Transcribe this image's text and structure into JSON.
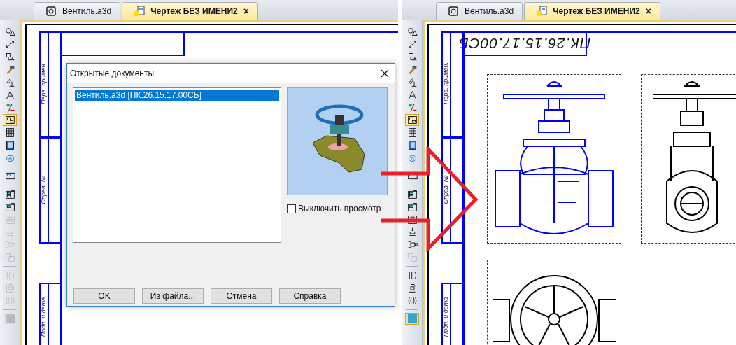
{
  "panels": [
    {
      "kind": "covered-sheet",
      "tabs": [
        {
          "label": "Вентиль.a3d",
          "kind": "model",
          "selected": false
        },
        {
          "label": "Чертеж БЕЗ ИМЕНИ2",
          "kind": "drawing",
          "selected": true,
          "close": "×"
        }
      ],
      "toolbar": [
        {
          "kind": "tool",
          "selected": false,
          "disabled": false
        },
        {
          "kind": "tool",
          "selected": false,
          "disabled": false
        },
        {
          "kind": "tool",
          "selected": false,
          "disabled": false
        },
        {
          "kind": "tool",
          "selected": false,
          "disabled": false
        },
        {
          "kind": "tool",
          "selected": false,
          "disabled": false
        },
        {
          "kind": "tool",
          "selected": false,
          "disabled": false
        },
        {
          "kind": "tool",
          "selected": false,
          "disabled": false
        },
        {
          "kind": "tool",
          "selected": true,
          "disabled": false
        },
        {
          "kind": "tool",
          "selected": false,
          "disabled": false
        },
        {
          "kind": "tool",
          "selected": false,
          "disabled": false
        },
        {
          "kind": "tool",
          "selected": false,
          "disabled": false
        },
        {
          "kind": "separator"
        },
        {
          "kind": "tool",
          "selected": false,
          "disabled": false
        },
        {
          "kind": "separator"
        },
        {
          "kind": "tool",
          "selected": false,
          "disabled": false
        },
        {
          "kind": "tool",
          "selected": false,
          "disabled": false
        },
        {
          "kind": "tool",
          "selected": false,
          "disabled": true
        },
        {
          "kind": "tool",
          "selected": false,
          "disabled": true
        },
        {
          "kind": "tool",
          "selected": false,
          "disabled": true
        },
        {
          "kind": "tool",
          "selected": false,
          "disabled": true
        },
        {
          "kind": "separator"
        },
        {
          "kind": "tool",
          "selected": false,
          "disabled": true
        },
        {
          "kind": "tool",
          "selected": false,
          "disabled": true
        },
        {
          "kind": "tool",
          "selected": false,
          "disabled": true
        },
        {
          "kind": "separator"
        },
        {
          "kind": "tool",
          "selected": false,
          "disabled": true
        }
      ],
      "margin_labels": [
        "Перв. примен.",
        "Справ. №",
        "Подп. и дата"
      ]
    },
    {
      "kind": "sheet-with-views",
      "tabs": [
        {
          "label": "Вентиль.a3d",
          "kind": "model",
          "selected": false
        },
        {
          "label": "Чертеж БЕЗ ИМЕНИ2",
          "kind": "drawing",
          "selected": true,
          "close": "×"
        }
      ],
      "toolbar": [
        {
          "kind": "tool",
          "selected": false,
          "disabled": false
        },
        {
          "kind": "tool",
          "selected": false,
          "disabled": false
        },
        {
          "kind": "tool",
          "selected": false,
          "disabled": false
        },
        {
          "kind": "tool",
          "selected": false,
          "disabled": false
        },
        {
          "kind": "tool",
          "selected": false,
          "disabled": false
        },
        {
          "kind": "tool",
          "selected": false,
          "disabled": false
        },
        {
          "kind": "tool",
          "selected": false,
          "disabled": false
        },
        {
          "kind": "tool",
          "selected": true,
          "disabled": false
        },
        {
          "kind": "tool",
          "selected": false,
          "disabled": false
        },
        {
          "kind": "tool",
          "selected": false,
          "disabled": false
        },
        {
          "kind": "tool",
          "selected": false,
          "disabled": false
        },
        {
          "kind": "separator"
        },
        {
          "kind": "tool",
          "selected": false,
          "disabled": false
        },
        {
          "kind": "separator"
        },
        {
          "kind": "tool",
          "selected": false,
          "disabled": false
        },
        {
          "kind": "tool",
          "selected": false,
          "disabled": false
        },
        {
          "kind": "tool",
          "selected": false,
          "disabled": false
        },
        {
          "kind": "tool",
          "selected": false,
          "disabled": false
        },
        {
          "kind": "tool",
          "selected": false,
          "disabled": false
        },
        {
          "kind": "tool",
          "selected": false,
          "disabled": true
        },
        {
          "kind": "separator"
        },
        {
          "kind": "tool",
          "selected": false,
          "disabled": false
        },
        {
          "kind": "tool",
          "selected": false,
          "disabled": false
        },
        {
          "kind": "tool",
          "selected": false,
          "disabled": false
        },
        {
          "kind": "separator"
        },
        {
          "kind": "tool",
          "selected": true,
          "disabled": false
        }
      ],
      "margin_labels": [
        "Перв. примен.",
        "Справ. №",
        "Подп. и дата"
      ],
      "stamp": "ПК.26.15.17.00СБ"
    }
  ],
  "dialog": {
    "title": "Открытые документы",
    "items": [
      {
        "label": "Вентиль.a3d [ПК.26.15.17.00СБ]",
        "selected": true
      }
    ],
    "checkbox": {
      "label": "Выключить просмотр",
      "checked": false
    },
    "buttons": [
      "OK",
      "Из файла...",
      "Отмена",
      "Справка"
    ]
  }
}
